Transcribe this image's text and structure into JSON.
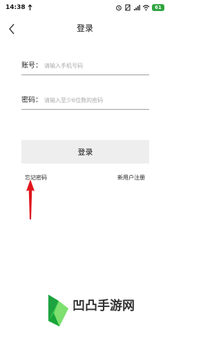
{
  "status_bar": {
    "time": "14:38",
    "battery": "61",
    "icons": [
      "alarm-icon",
      "no-sim-icon",
      "signal-icon",
      "wifi-icon",
      "battery-icon"
    ]
  },
  "header": {
    "title": "登录",
    "back_icon": "chevron-left-icon"
  },
  "form": {
    "account": {
      "label": "账号：",
      "placeholder": "请输入手机号码",
      "value": ""
    },
    "password": {
      "label": "密码：",
      "placeholder": "请输入至少6位数的密码",
      "value": ""
    },
    "login_label": "登录"
  },
  "links": {
    "forgot": "忘记密码",
    "register": "新用户注册"
  },
  "watermark": {
    "text": "凹凸手游网",
    "logo_icon": "play-triangle-logo-icon"
  },
  "colors": {
    "annotation_arrow": "#e0161d",
    "battery": "#2fa43f",
    "button_bg": "#eeeeee",
    "watermark_green": "#34c94f"
  }
}
